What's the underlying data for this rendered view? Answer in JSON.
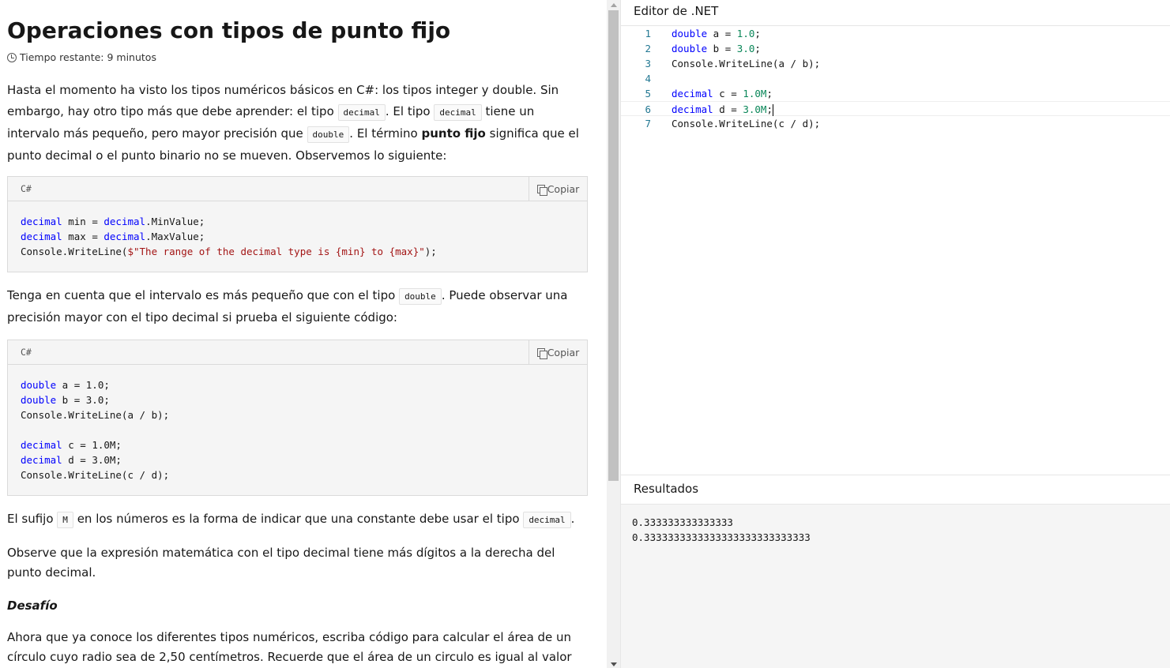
{
  "article": {
    "title": "Operaciones con tipos de punto fijo",
    "time_remaining": "Tiempo restante: 9 minutos",
    "p1": {
      "t1": "Hasta el momento ha visto los tipos numéricos básicos en C#: los tipos integer y double. Sin embargo, hay otro tipo más que debe aprender: el tipo ",
      "c1": "decimal",
      "t2": ". El tipo ",
      "c2": "decimal",
      "t3": " tiene un intervalo más pequeño, pero mayor precisión que ",
      "c3": "double",
      "t4": ". El término ",
      "bold": "punto fijo",
      "t5": " significa que el punto decimal o el punto binario no se mueven. Observemos lo siguiente:"
    },
    "code1": {
      "lang": "C#",
      "copy": "Copiar",
      "lines": [
        [
          {
            "t": "decimal",
            "c": "kw"
          },
          {
            "t": " min = "
          },
          {
            "t": "decimal",
            "c": "kw"
          },
          {
            "t": ".MinValue;"
          }
        ],
        [
          {
            "t": "decimal",
            "c": "kw"
          },
          {
            "t": " max = "
          },
          {
            "t": "decimal",
            "c": "kw"
          },
          {
            "t": ".MaxValue;"
          }
        ],
        [
          {
            "t": "Console.WriteLine("
          },
          {
            "t": "$\"The range of the decimal type is {min} to {max}\"",
            "c": "str"
          },
          {
            "t": ");"
          }
        ]
      ]
    },
    "p2": {
      "t1": "Tenga en cuenta que el intervalo es más pequeño que con el tipo ",
      "c1": "double",
      "t2": ". Puede observar una precisión mayor con el tipo decimal si prueba el siguiente código:"
    },
    "code2": {
      "lang": "C#",
      "copy": "Copiar",
      "lines": [
        [
          {
            "t": "double",
            "c": "kw"
          },
          {
            "t": " a = 1.0;"
          }
        ],
        [
          {
            "t": "double",
            "c": "kw"
          },
          {
            "t": " b = 3.0;"
          }
        ],
        [
          {
            "t": "Console.WriteLine(a / b);"
          }
        ],
        [
          {
            "t": ""
          }
        ],
        [
          {
            "t": "decimal",
            "c": "kw"
          },
          {
            "t": " c = 1.0M;"
          }
        ],
        [
          {
            "t": "decimal",
            "c": "kw"
          },
          {
            "t": " d = 3.0M;"
          }
        ],
        [
          {
            "t": "Console.WriteLine(c / d);"
          }
        ]
      ]
    },
    "p3": {
      "t1": "El sufijo ",
      "c1": "M",
      "t2": " en los números es la forma de indicar que una constante debe usar el tipo ",
      "c2": "decimal",
      "t3": "."
    },
    "p4": "Observe que la expresión matemática con el tipo decimal tiene más dígitos a la derecha del punto decimal.",
    "challenge": "Desafío",
    "p5": "Ahora que ya conoce los diferentes tipos numéricos, escriba código para calcular el área de un círculo cuyo radio sea de 2,50 centímetros. Recuerde que el área de un circulo es igual al valor de su radio"
  },
  "editor": {
    "title": "Editor de .NET",
    "lines": [
      {
        "n": "1",
        "tokens": [
          {
            "t": "double",
            "c": "kw"
          },
          {
            "t": " a = "
          },
          {
            "t": "1.0",
            "c": "num"
          },
          {
            "t": ";"
          }
        ]
      },
      {
        "n": "2",
        "tokens": [
          {
            "t": "double",
            "c": "kw"
          },
          {
            "t": " b = "
          },
          {
            "t": "3.0",
            "c": "num"
          },
          {
            "t": ";"
          }
        ]
      },
      {
        "n": "3",
        "tokens": [
          {
            "t": "Console.WriteLine(a / b);"
          }
        ]
      },
      {
        "n": "4",
        "tokens": [
          {
            "t": ""
          }
        ]
      },
      {
        "n": "5",
        "tokens": [
          {
            "t": "decimal",
            "c": "kw"
          },
          {
            "t": " c = "
          },
          {
            "t": "1.0M",
            "c": "num"
          },
          {
            "t": ";"
          }
        ]
      },
      {
        "n": "6",
        "tokens": [
          {
            "t": "decimal",
            "c": "kw"
          },
          {
            "t": " d = "
          },
          {
            "t": "3.0M",
            "c": "num"
          },
          {
            "t": ";"
          }
        ],
        "current": true
      },
      {
        "n": "7",
        "tokens": [
          {
            "t": "Console.WriteLine(c / d);"
          }
        ]
      }
    ]
  },
  "results": {
    "title": "Resultados",
    "lines": [
      "0.333333333333333",
      "0.3333333333333333333333333333"
    ]
  }
}
